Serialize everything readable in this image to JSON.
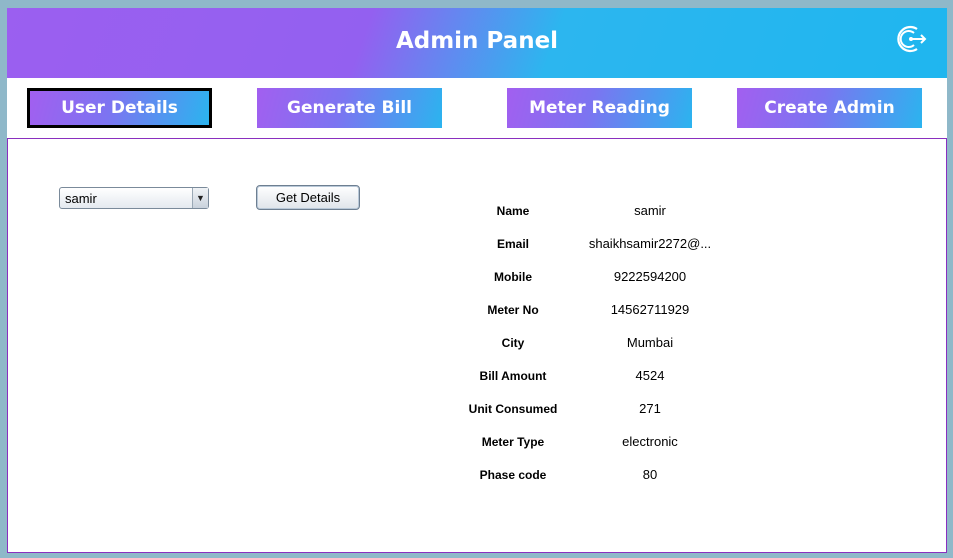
{
  "header": {
    "title": "Admin Panel"
  },
  "nav": [
    {
      "label": "User Details",
      "active": true
    },
    {
      "label": "Generate Bill",
      "active": false
    },
    {
      "label": "Meter Reading",
      "active": false
    },
    {
      "label": "Create Admin",
      "active": false
    }
  ],
  "form": {
    "selected_user": "samir",
    "get_details_label": "Get Details"
  },
  "details": [
    {
      "label": "Name",
      "value": "samir"
    },
    {
      "label": "Email",
      "value": "shaikhsamir2272@..."
    },
    {
      "label": "Mobile",
      "value": "9222594200"
    },
    {
      "label": "Meter No",
      "value": "14562711929"
    },
    {
      "label": "City",
      "value": "Mumbai"
    },
    {
      "label": "Bill Amount",
      "value": "4524"
    },
    {
      "label": "Unit Consumed",
      "value": "271"
    },
    {
      "label": "Meter Type",
      "value": "electronic"
    },
    {
      "label": "Phase code",
      "value": "80"
    }
  ],
  "icons": {
    "logout": "logout-icon"
  },
  "colors": {
    "accent_purple": "#9b5ff0",
    "accent_blue": "#1fb6ef",
    "content_border": "#8a2fbf"
  }
}
